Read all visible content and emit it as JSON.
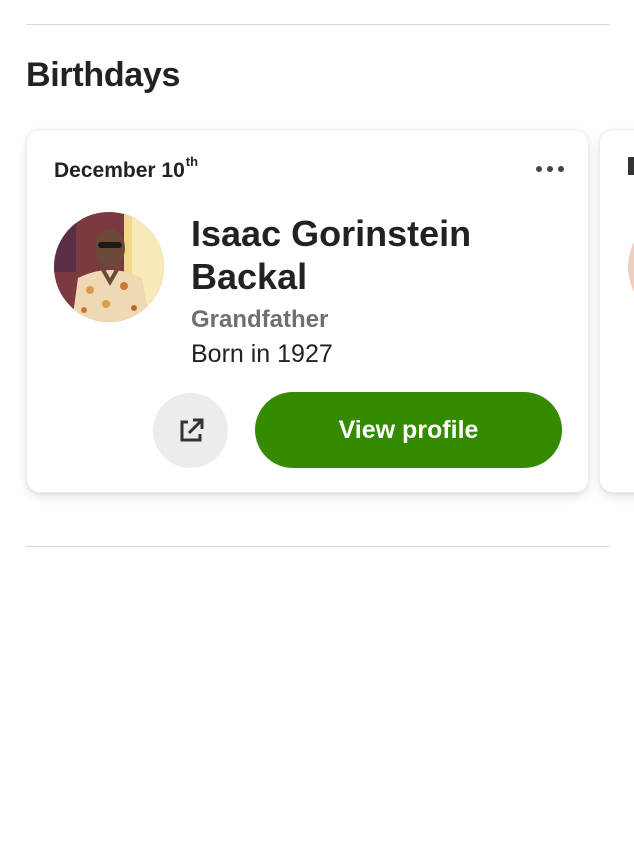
{
  "section": {
    "title": "Birthdays"
  },
  "cards": [
    {
      "date_month_day": "December 10",
      "date_suffix": "th",
      "more_icon": "more-horizontal-icon",
      "name": "Isaac Gorinstein Backal",
      "relationship": "Grandfather",
      "born": "Born in 1927",
      "share_icon": "external-link-icon",
      "view_profile_label": "View profile",
      "accent_color": "#358a00"
    }
  ]
}
